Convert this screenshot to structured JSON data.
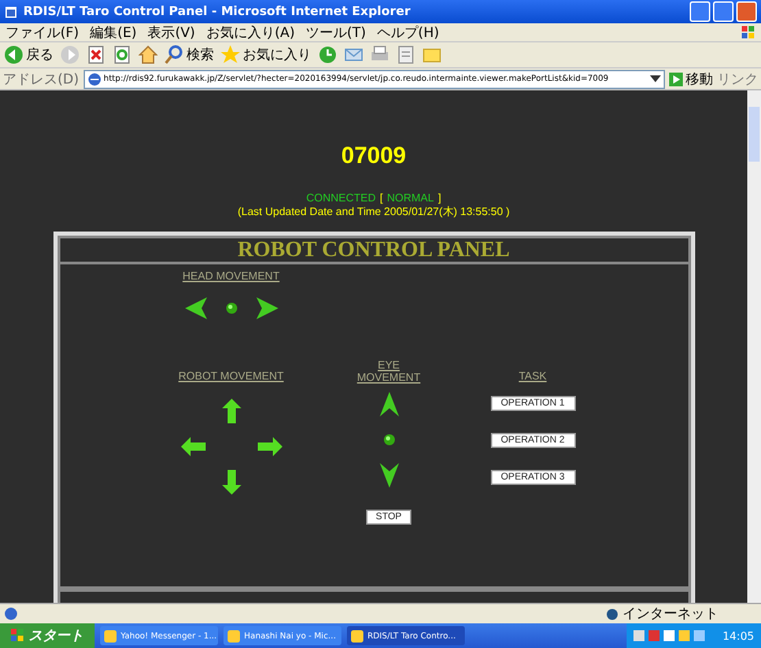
{
  "window": {
    "title": "RDIS/LT Taro Control Panel - Microsoft Internet Explorer"
  },
  "menu_bar": [
    "ファイル(F)",
    "編集(E)",
    "表示(V)",
    "お気に入り(A)",
    "ツール(T)",
    "ヘルプ(H)"
  ],
  "toolbar": [
    {
      "kind": "back",
      "label": "戻る"
    },
    {
      "kind": "forward"
    },
    {
      "kind": "stop"
    },
    {
      "kind": "refresh"
    },
    {
      "kind": "home"
    },
    {
      "kind": "search",
      "label": "検索"
    },
    {
      "kind": "favorites",
      "label": "お気に入り"
    },
    {
      "kind": "history"
    },
    {
      "kind": "mail"
    },
    {
      "kind": "print"
    },
    {
      "kind": "edit"
    },
    {
      "kind": "folder"
    }
  ],
  "address_bar": {
    "label": "アドレス(D)",
    "url": "http://rdis92.furukawakk.jp/Z/servlet/?hecter=2020163994/servlet/jp.co.reudo.intermainte.viewer.makePortList&kid=7009",
    "go_label": "移動",
    "links_label": "リンク"
  },
  "page": {
    "robot_id": "07009",
    "status_line": [
      {
        "kind": "state",
        "text": "CONNECTED"
      },
      {
        "kind": "bracket",
        "text": "["
      },
      {
        "kind": "state",
        "text": "NORMAL"
      },
      {
        "kind": "bracket",
        "text": "]"
      }
    ],
    "last_updated": "(Last Updated Date and Time 2005/01/27(木) 13:55:50 )"
  },
  "panel": {
    "title": "ROBOT CONTROL PANEL",
    "head_movement": "HEAD MOVEMENT",
    "robot_movement": "ROBOT MOVEMENT",
    "eye_movement": "EYE MOVEMENT",
    "task": "TASK",
    "task_buttons": [
      "OPERATION 1",
      "OPERATION 2",
      "OPERATION 3"
    ],
    "stop_button": "STOP"
  },
  "status_bar": {
    "zone": "インターネット"
  },
  "taskbar": {
    "start": "スタート",
    "tasks": [
      {
        "label": "Yahoo! Messenger - 1...",
        "selected": false
      },
      {
        "label": "Hanashi Nai yo - Mic...",
        "selected": false
      },
      {
        "label": "RDIS/LT Taro Contro...",
        "selected": true
      }
    ],
    "clock": "14:05"
  }
}
